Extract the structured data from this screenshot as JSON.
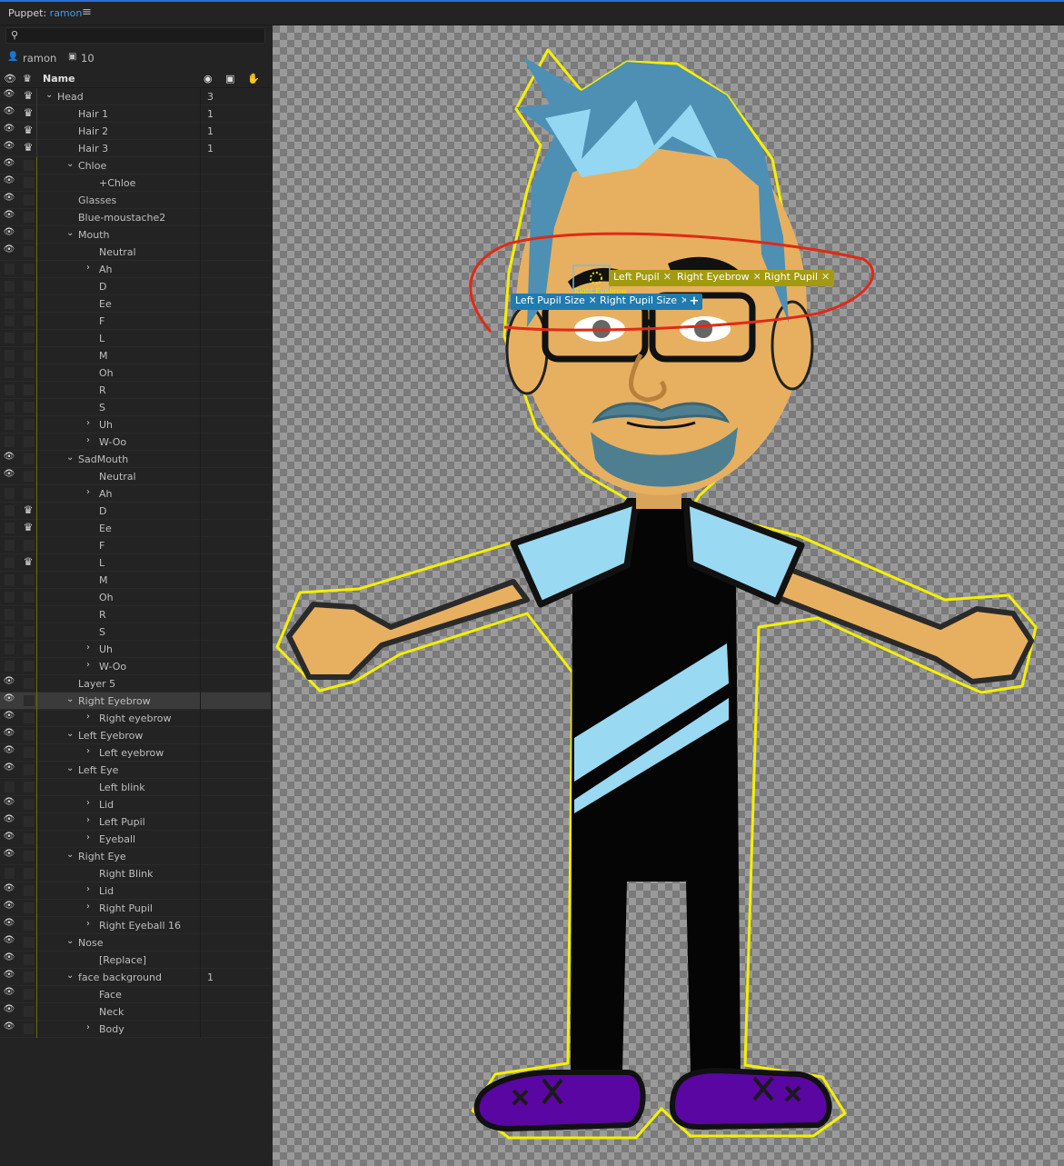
{
  "panel": {
    "prefix": "Puppet:",
    "puppet_name": "ramon",
    "menu_icon": "hamburger-icon"
  },
  "search": {
    "placeholder": "",
    "icon": "search-icon"
  },
  "info": {
    "puppet": "ramon",
    "count": "10"
  },
  "columns": {
    "name": "Name"
  },
  "tree": [
    {
      "label": "Head",
      "depth": 0,
      "eye": true,
      "crown": true,
      "chev": "down",
      "count": "3"
    },
    {
      "label": "Hair 1",
      "depth": 1,
      "eye": true,
      "crown": true,
      "count": "1"
    },
    {
      "label": "Hair 2",
      "depth": 1,
      "eye": true,
      "crown": true,
      "count": "1"
    },
    {
      "label": "Hair 3",
      "depth": 1,
      "eye": true,
      "crown": true,
      "count": "1"
    },
    {
      "label": "Chloe",
      "depth": 1,
      "eye": true,
      "chev": "down"
    },
    {
      "label": "+Chloe",
      "depth": 2,
      "eye": true
    },
    {
      "label": "Glasses",
      "depth": 1,
      "eye": true
    },
    {
      "label": "Blue-moustache2",
      "depth": 1,
      "eye": true
    },
    {
      "label": "Mouth",
      "depth": 1,
      "eye": true,
      "chev": "down"
    },
    {
      "label": "Neutral",
      "depth": 2,
      "eye": true
    },
    {
      "label": "Ah",
      "depth": 2,
      "chev": "right"
    },
    {
      "label": "D",
      "depth": 2
    },
    {
      "label": "Ee",
      "depth": 2
    },
    {
      "label": "F",
      "depth": 2
    },
    {
      "label": "L",
      "depth": 2
    },
    {
      "label": "M",
      "depth": 2
    },
    {
      "label": "Oh",
      "depth": 2
    },
    {
      "label": "R",
      "depth": 2
    },
    {
      "label": "S",
      "depth": 2
    },
    {
      "label": "Uh",
      "depth": 2,
      "chev": "right"
    },
    {
      "label": "W-Oo",
      "depth": 2,
      "chev": "right"
    },
    {
      "label": "SadMouth",
      "depth": 1,
      "eye": true,
      "chev": "down"
    },
    {
      "label": "Neutral",
      "depth": 2,
      "eye": true
    },
    {
      "label": "Ah",
      "depth": 2,
      "chev": "right"
    },
    {
      "label": "D",
      "depth": 2,
      "crown": true
    },
    {
      "label": "Ee",
      "depth": 2,
      "crown": true
    },
    {
      "label": "F",
      "depth": 2
    },
    {
      "label": "L",
      "depth": 2,
      "crown": true
    },
    {
      "label": "M",
      "depth": 2
    },
    {
      "label": "Oh",
      "depth": 2
    },
    {
      "label": "R",
      "depth": 2
    },
    {
      "label": "S",
      "depth": 2
    },
    {
      "label": "Uh",
      "depth": 2,
      "chev": "right"
    },
    {
      "label": "W-Oo",
      "depth": 2,
      "chev": "right"
    },
    {
      "label": "Layer 5",
      "depth": 1,
      "eye": true
    },
    {
      "label": "Right Eyebrow",
      "depth": 1,
      "eye": true,
      "chev": "down",
      "selected": true
    },
    {
      "label": "Right eyebrow",
      "depth": 2,
      "eye": true,
      "chev": "right"
    },
    {
      "label": "Left Eyebrow",
      "depth": 1,
      "eye": true,
      "chev": "down"
    },
    {
      "label": "Left eyebrow",
      "depth": 2,
      "eye": true,
      "chev": "right"
    },
    {
      "label": "Left Eye",
      "depth": 1,
      "eye": true,
      "chev": "down"
    },
    {
      "label": "Left blink",
      "depth": 2
    },
    {
      "label": "Lid",
      "depth": 2,
      "eye": true,
      "chev": "right"
    },
    {
      "label": "Left Pupil",
      "depth": 2,
      "eye": true,
      "chev": "right"
    },
    {
      "label": "Eyeball",
      "depth": 2,
      "eye": true,
      "chev": "right"
    },
    {
      "label": "Right Eye",
      "depth": 1,
      "eye": true,
      "chev": "down"
    },
    {
      "label": "Right Blink",
      "depth": 2
    },
    {
      "label": "Lid",
      "depth": 2,
      "eye": true,
      "chev": "right"
    },
    {
      "label": "Right Pupil",
      "depth": 2,
      "eye": true,
      "chev": "right"
    },
    {
      "label": "Right Eyeball 16",
      "depth": 2,
      "eye": true,
      "chev": "right"
    },
    {
      "label": "Nose",
      "depth": 1,
      "eye": true,
      "chev": "down"
    },
    {
      "label": "[Replace]",
      "depth": 2,
      "eye": true
    },
    {
      "label": "face background",
      "depth": 1,
      "eye": true,
      "chev": "down",
      "count": "1"
    },
    {
      "label": "Face",
      "depth": 2,
      "eye": true
    },
    {
      "label": "Neck",
      "depth": 2,
      "eye": true
    },
    {
      "label": "Body",
      "depth": 2,
      "eye": true,
      "chev": "right"
    }
  ],
  "tags": {
    "row1": [
      "Left Pupil",
      "Right Eyebrow",
      "Right Pupil"
    ],
    "row2": [
      "Left Pupil Size",
      "Right Pupil Size"
    ],
    "handle_label": "Right Eyebrow"
  },
  "colors": {
    "tag_olive": "#a39a10",
    "tag_blue": "#1f7bb0",
    "outline": "#f4f000",
    "annotation": "#e02a14"
  }
}
